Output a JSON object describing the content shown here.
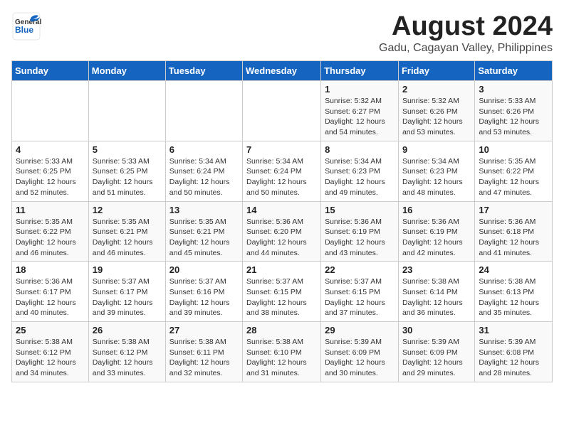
{
  "header": {
    "logo_general": "General",
    "logo_blue": "Blue",
    "title": "August 2024",
    "subtitle": "Gadu, Cagayan Valley, Philippines"
  },
  "weekdays": [
    "Sunday",
    "Monday",
    "Tuesday",
    "Wednesday",
    "Thursday",
    "Friday",
    "Saturday"
  ],
  "weeks": [
    [
      {
        "day": "",
        "info": ""
      },
      {
        "day": "",
        "info": ""
      },
      {
        "day": "",
        "info": ""
      },
      {
        "day": "",
        "info": ""
      },
      {
        "day": "1",
        "info": "Sunrise: 5:32 AM\nSunset: 6:27 PM\nDaylight: 12 hours\nand 54 minutes."
      },
      {
        "day": "2",
        "info": "Sunrise: 5:32 AM\nSunset: 6:26 PM\nDaylight: 12 hours\nand 53 minutes."
      },
      {
        "day": "3",
        "info": "Sunrise: 5:33 AM\nSunset: 6:26 PM\nDaylight: 12 hours\nand 53 minutes."
      }
    ],
    [
      {
        "day": "4",
        "info": "Sunrise: 5:33 AM\nSunset: 6:25 PM\nDaylight: 12 hours\nand 52 minutes."
      },
      {
        "day": "5",
        "info": "Sunrise: 5:33 AM\nSunset: 6:25 PM\nDaylight: 12 hours\nand 51 minutes."
      },
      {
        "day": "6",
        "info": "Sunrise: 5:34 AM\nSunset: 6:24 PM\nDaylight: 12 hours\nand 50 minutes."
      },
      {
        "day": "7",
        "info": "Sunrise: 5:34 AM\nSunset: 6:24 PM\nDaylight: 12 hours\nand 50 minutes."
      },
      {
        "day": "8",
        "info": "Sunrise: 5:34 AM\nSunset: 6:23 PM\nDaylight: 12 hours\nand 49 minutes."
      },
      {
        "day": "9",
        "info": "Sunrise: 5:34 AM\nSunset: 6:23 PM\nDaylight: 12 hours\nand 48 minutes."
      },
      {
        "day": "10",
        "info": "Sunrise: 5:35 AM\nSunset: 6:22 PM\nDaylight: 12 hours\nand 47 minutes."
      }
    ],
    [
      {
        "day": "11",
        "info": "Sunrise: 5:35 AM\nSunset: 6:22 PM\nDaylight: 12 hours\nand 46 minutes."
      },
      {
        "day": "12",
        "info": "Sunrise: 5:35 AM\nSunset: 6:21 PM\nDaylight: 12 hours\nand 46 minutes."
      },
      {
        "day": "13",
        "info": "Sunrise: 5:35 AM\nSunset: 6:21 PM\nDaylight: 12 hours\nand 45 minutes."
      },
      {
        "day": "14",
        "info": "Sunrise: 5:36 AM\nSunset: 6:20 PM\nDaylight: 12 hours\nand 44 minutes."
      },
      {
        "day": "15",
        "info": "Sunrise: 5:36 AM\nSunset: 6:19 PM\nDaylight: 12 hours\nand 43 minutes."
      },
      {
        "day": "16",
        "info": "Sunrise: 5:36 AM\nSunset: 6:19 PM\nDaylight: 12 hours\nand 42 minutes."
      },
      {
        "day": "17",
        "info": "Sunrise: 5:36 AM\nSunset: 6:18 PM\nDaylight: 12 hours\nand 41 minutes."
      }
    ],
    [
      {
        "day": "18",
        "info": "Sunrise: 5:36 AM\nSunset: 6:17 PM\nDaylight: 12 hours\nand 40 minutes."
      },
      {
        "day": "19",
        "info": "Sunrise: 5:37 AM\nSunset: 6:17 PM\nDaylight: 12 hours\nand 39 minutes."
      },
      {
        "day": "20",
        "info": "Sunrise: 5:37 AM\nSunset: 6:16 PM\nDaylight: 12 hours\nand 39 minutes."
      },
      {
        "day": "21",
        "info": "Sunrise: 5:37 AM\nSunset: 6:15 PM\nDaylight: 12 hours\nand 38 minutes."
      },
      {
        "day": "22",
        "info": "Sunrise: 5:37 AM\nSunset: 6:15 PM\nDaylight: 12 hours\nand 37 minutes."
      },
      {
        "day": "23",
        "info": "Sunrise: 5:38 AM\nSunset: 6:14 PM\nDaylight: 12 hours\nand 36 minutes."
      },
      {
        "day": "24",
        "info": "Sunrise: 5:38 AM\nSunset: 6:13 PM\nDaylight: 12 hours\nand 35 minutes."
      }
    ],
    [
      {
        "day": "25",
        "info": "Sunrise: 5:38 AM\nSunset: 6:12 PM\nDaylight: 12 hours\nand 34 minutes."
      },
      {
        "day": "26",
        "info": "Sunrise: 5:38 AM\nSunset: 6:12 PM\nDaylight: 12 hours\nand 33 minutes."
      },
      {
        "day": "27",
        "info": "Sunrise: 5:38 AM\nSunset: 6:11 PM\nDaylight: 12 hours\nand 32 minutes."
      },
      {
        "day": "28",
        "info": "Sunrise: 5:38 AM\nSunset: 6:10 PM\nDaylight: 12 hours\nand 31 minutes."
      },
      {
        "day": "29",
        "info": "Sunrise: 5:39 AM\nSunset: 6:09 PM\nDaylight: 12 hours\nand 30 minutes."
      },
      {
        "day": "30",
        "info": "Sunrise: 5:39 AM\nSunset: 6:09 PM\nDaylight: 12 hours\nand 29 minutes."
      },
      {
        "day": "31",
        "info": "Sunrise: 5:39 AM\nSunset: 6:08 PM\nDaylight: 12 hours\nand 28 minutes."
      }
    ]
  ]
}
